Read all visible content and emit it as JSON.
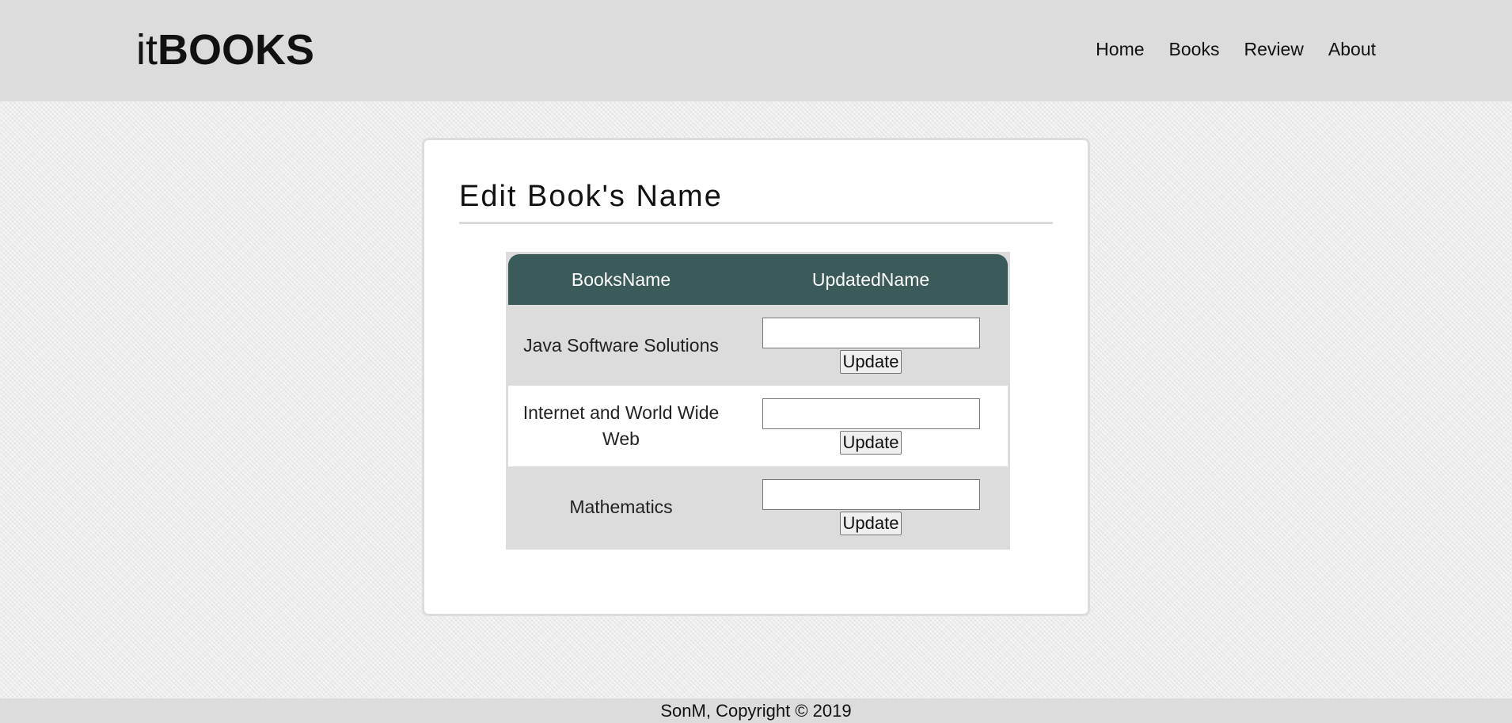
{
  "header": {
    "logo_light": "it",
    "logo_bold": "BOOKS",
    "nav": [
      {
        "label": "Home"
      },
      {
        "label": "Books"
      },
      {
        "label": "Review"
      },
      {
        "label": "About"
      }
    ]
  },
  "main": {
    "title": "Edit Book's Name",
    "table": {
      "columns": [
        "BooksName",
        "UpdatedName"
      ],
      "rows": [
        {
          "name": "Java Software Solutions",
          "value": "",
          "button": "Update"
        },
        {
          "name": "Internet and World Wide Web",
          "value": "",
          "button": "Update"
        },
        {
          "name": "Mathematics",
          "value": "",
          "button": "Update"
        }
      ]
    }
  },
  "footer": {
    "text": "SonM, Copyright © 2019"
  },
  "colors": {
    "header_bg": "#dcdcdc",
    "table_header_bg": "#3b5a5a",
    "card_bg": "#ffffff"
  }
}
